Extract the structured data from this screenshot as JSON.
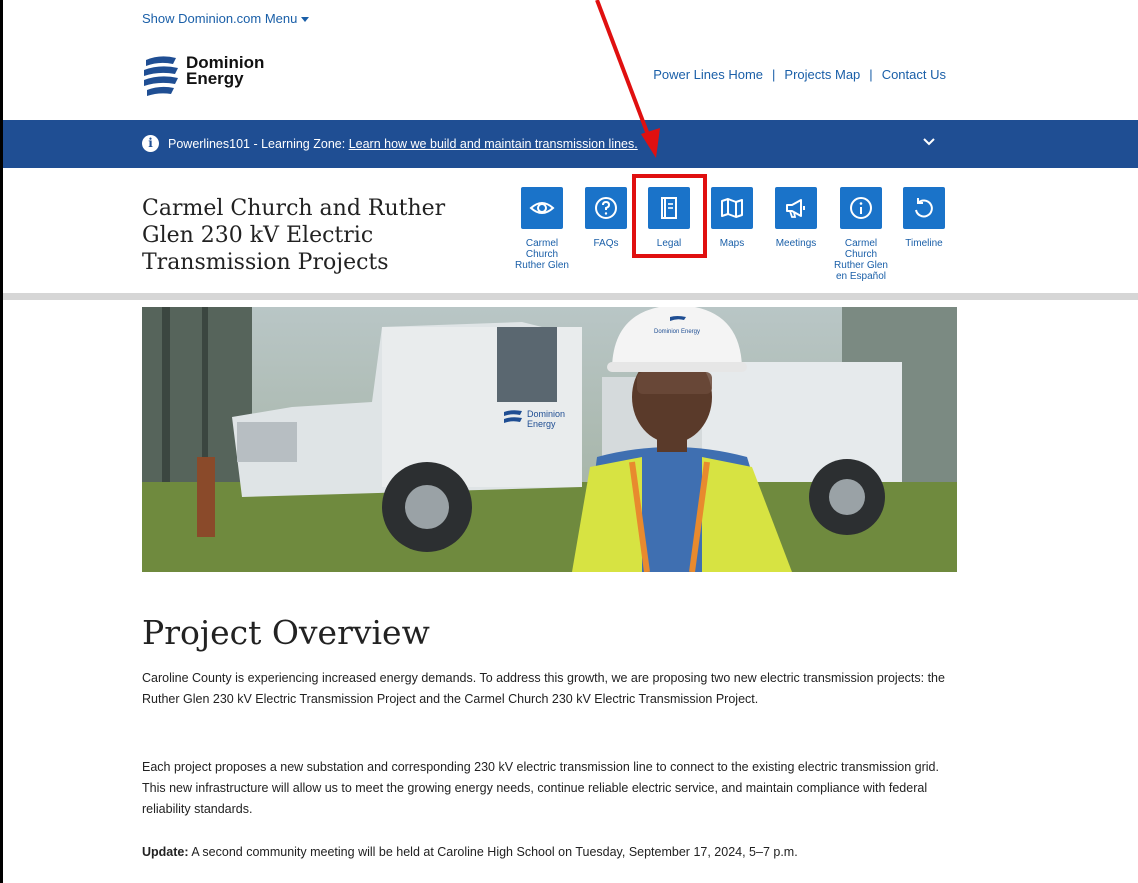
{
  "header": {
    "show_menu": "Show Dominion.com Menu",
    "logo_line1": "Dominion",
    "logo_line2": "Energy",
    "links": [
      "Power Lines Home",
      "Projects Map",
      "Contact Us"
    ],
    "link_separator": "|"
  },
  "banner": {
    "prefix": "Powerlines101 - Learning Zone:",
    "link": "Learn how we build and maintain transmission lines."
  },
  "project": {
    "title": "Carmel Church and Ruther Glen 230 kV Electric Transmission Projects",
    "nav": [
      {
        "label": "Carmel Church Ruther Glen",
        "icon": "eye-icon"
      },
      {
        "label": "FAQs",
        "icon": "question-icon"
      },
      {
        "label": "Legal",
        "icon": "book-icon"
      },
      {
        "label": "Maps",
        "icon": "map-icon"
      },
      {
        "label": "Meetings",
        "icon": "megaphone-icon"
      },
      {
        "label": "Carmel Church Ruther Glen en Español",
        "icon": "info-icon"
      },
      {
        "label": "Timeline",
        "icon": "undo-icon"
      }
    ]
  },
  "hero": {
    "truck_logo_line1": "Dominion",
    "truck_logo_line2": "Energy",
    "helmet_logo": "Dominion Energy"
  },
  "content": {
    "heading": "Project Overview",
    "paragraph1": "Caroline County is experiencing increased energy demands. To address this growth, we are proposing two new electric transmission projects: the Ruther Glen 230 kV Electric Transmission Project and the Carmel Church 230 kV Electric Transmission Project.",
    "paragraph2": "Each project proposes a new substation and corresponding 230 kV electric transmission line to connect to the existing electric transmission grid. This new infrastructure will allow us to meet the growing energy needs, continue reliable electric service, and maintain compliance with federal reliability standards.",
    "update_label": "Update:",
    "update_text": " A second community meeting will be held at Caroline High School on Tuesday, September 17, 2024, 5–7 p.m."
  },
  "colors": {
    "brand_blue": "#1f4e93",
    "icon_blue": "#1a73c9",
    "link_blue": "#1a5fa8",
    "annotation_red": "#e01010"
  }
}
